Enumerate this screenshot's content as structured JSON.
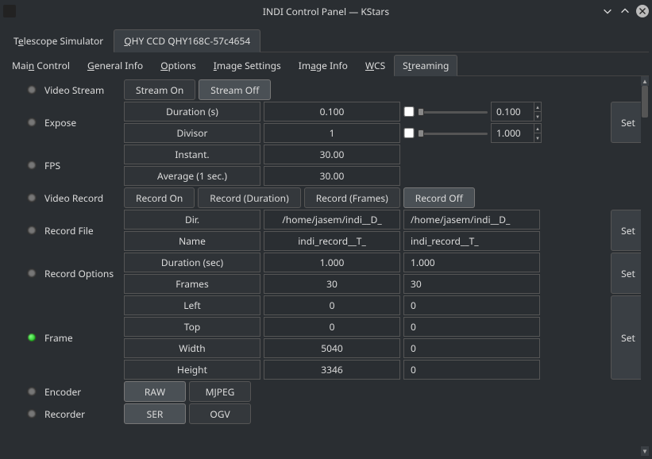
{
  "window": {
    "title": "INDI Control Panel — KStars"
  },
  "device_tabs": [
    {
      "label_pre": "T",
      "label_ul": "e",
      "label_post": "lescope Simulator",
      "active": false
    },
    {
      "label_pre": "",
      "label_ul": "Q",
      "label_post": "HY CCD QHY168C-57c4654",
      "active": true
    }
  ],
  "sub_tabs": [
    {
      "pre": "Mai",
      "ul": "n",
      "post": " Control"
    },
    {
      "pre": "",
      "ul": "G",
      "post": "eneral Info"
    },
    {
      "pre": "",
      "ul": "O",
      "post": "ptions"
    },
    {
      "pre": "",
      "ul": "I",
      "post": "mage Settings"
    },
    {
      "pre": "Im",
      "ul": "a",
      "post": "ge Info"
    },
    {
      "pre": "",
      "ul": "W",
      "post": "CS"
    },
    {
      "pre": "S",
      "ul": "t",
      "post": "reaming"
    }
  ],
  "videoStream": {
    "label": "Video Stream",
    "on_pre": "",
    "on_ul": "S",
    "on_post": "tream On",
    "off": "Stream Off"
  },
  "expose": {
    "label": "Expose",
    "duration_hdr": "Duration (s)",
    "duration_val": "0.100",
    "duration_spin": "0.100",
    "divisor_hdr": "Divisor",
    "divisor_val": "1",
    "divisor_spin": "1.000",
    "set": "Set"
  },
  "fps": {
    "label": "FPS",
    "instant_hdr": "Instant.",
    "instant_val": "30.00",
    "avg_hdr": "Average (1 sec.)",
    "avg_val": "30.00"
  },
  "videoRecord": {
    "label": "Video Record",
    "on_pre": "",
    "on_ul": "R",
    "on_post": "ecord On",
    "dur_pre": "Record (",
    "dur_ul": "D",
    "dur_post": "uration)",
    "fr_pre": "Record (",
    "fr_ul": "F",
    "fr_post": "rames)",
    "off": "Record Off"
  },
  "recordFile": {
    "label": "Record File",
    "dir_hdr": "Dir.",
    "dir_val": "/home/jasem/indi__D_",
    "dir_in": "/home/jasem/indi__D_",
    "name_hdr": "Name",
    "name_val": "indi_record__T_",
    "name_in": "indi_record__T_",
    "set": "Set"
  },
  "recordOptions": {
    "label": "Record Options",
    "dur_hdr": "Duration (sec)",
    "dur_val": "1.000",
    "dur_in": "1.000",
    "fr_hdr": "Frames",
    "fr_val": "30",
    "fr_in": "30",
    "set": "Set"
  },
  "frame": {
    "label": "Frame",
    "left_hdr": "Left",
    "left_val": "0",
    "left_in": "0",
    "top_hdr": "Top",
    "top_val": "0",
    "top_in": "0",
    "width_hdr": "Width",
    "width_val": "5040",
    "width_in": "0",
    "height_hdr": "Height",
    "height_val": "3346",
    "height_in": "0",
    "set": "Set"
  },
  "encoder": {
    "label": "Encoder",
    "raw_pre": "R",
    "raw_ul": "A",
    "raw_post": "W",
    "mjpeg_pre": "",
    "mjpeg_ul": "M",
    "mjpeg_post": "JPEG"
  },
  "recorder": {
    "label": "Recorder",
    "ser": "SER",
    "ogv_pre": "",
    "ogv_ul": "O",
    "ogv_post": "GV"
  }
}
